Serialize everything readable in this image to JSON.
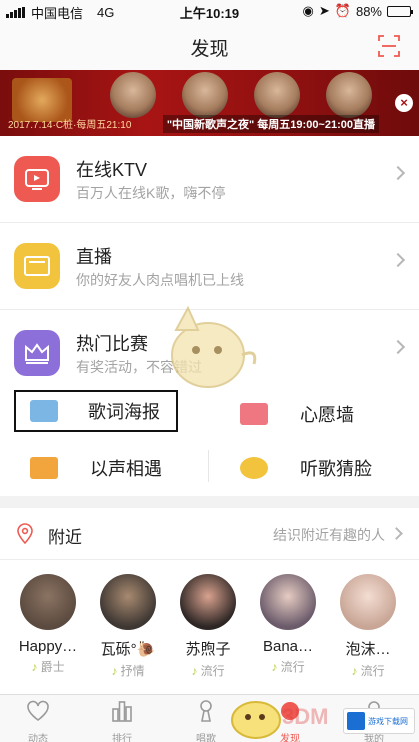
{
  "status_bar": {
    "carrier": "中国电信",
    "network": "4G",
    "time": "上午10:19",
    "battery": "88%",
    "battery_level": 0.88
  },
  "nav": {
    "title": "发现"
  },
  "banner": {
    "caption": "\"中国新歌声之夜\" 每周五19:00~21:00直播",
    "small_text": "2017.7.14·C桩·每周五21:10"
  },
  "list": [
    {
      "title": "在线KTV",
      "subtitle": "百万人在线K歌，嗨不停",
      "icon": "ktv-tv-icon",
      "color": "#ee5a52"
    },
    {
      "title": "直播",
      "subtitle": "你的好友人肉点唱机已上线",
      "icon": "live-screen-icon",
      "color": "#f2c43d"
    },
    {
      "title": "热门比赛",
      "subtitle": "有奖活动，不容错过",
      "icon": "crown-icon",
      "color": "#8d6fd9"
    }
  ],
  "grid": [
    {
      "label": "歌词海报",
      "icon": "lyric-poster-icon",
      "color": "#7cb6e4"
    },
    {
      "label": "心愿墙",
      "icon": "wish-wall-icon",
      "color": "#ee7781"
    },
    {
      "label": "以声相遇",
      "icon": "voice-meet-icon",
      "color": "#f2a43d"
    },
    {
      "label": "听歌猜脸",
      "icon": "guess-face-icon",
      "color": "#f2c43d"
    }
  ],
  "nearby": {
    "label": "附近",
    "hint": "结识附近有趣的人"
  },
  "users": [
    {
      "name": "Happy…",
      "tag": "爵士",
      "color": "#5b4a3f"
    },
    {
      "name": "瓦砾°🐌",
      "tag": "抒情",
      "color": "#3d3632"
    },
    {
      "name": "苏煦子",
      "tag": "流行",
      "color": "#2d2624"
    },
    {
      "name": "Bana…",
      "tag": "流行",
      "color": "#6a5a6a"
    },
    {
      "name": "泡沫…",
      "tag": "流行",
      "color": "#c8a595"
    }
  ],
  "tabs": [
    {
      "label": "动态",
      "icon": "heart-note-icon"
    },
    {
      "label": "排行",
      "icon": "chart-bars-icon"
    },
    {
      "label": "唱歌",
      "icon": "microphone-icon"
    },
    {
      "label": "发现",
      "icon": "discover-icon"
    },
    {
      "label": "我的",
      "icon": "profile-icon"
    }
  ],
  "watermark": {
    "text": "游戏下载网"
  }
}
